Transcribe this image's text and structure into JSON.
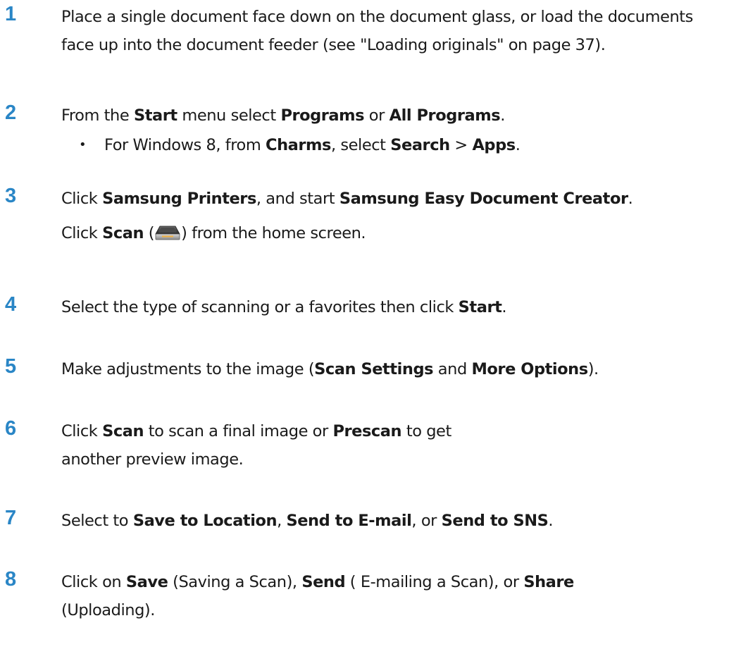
{
  "steps": [
    {
      "number": "1",
      "parts": [
        {
          "t": "Place a single document face down on the document glass, or load the documents face up into the document feeder (see \"Loading originals\" on page 37).",
          "b": false
        }
      ]
    },
    {
      "number": "2",
      "parts": [
        {
          "t": "From the ",
          "b": false
        },
        {
          "t": "Start",
          "b": true
        },
        {
          "t": " menu select ",
          "b": false
        },
        {
          "t": "Programs",
          "b": true
        },
        {
          "t": " or ",
          "b": false
        },
        {
          "t": "All Programs",
          "b": true
        },
        {
          "t": ".",
          "b": false
        }
      ],
      "bullet": [
        {
          "t": "For Windows 8, from ",
          "b": false
        },
        {
          "t": "Charms",
          "b": true
        },
        {
          "t": ", select ",
          "b": false
        },
        {
          "t": "Search",
          "b": true
        },
        {
          "t": " > ",
          "b": false
        },
        {
          "t": "Apps",
          "b": true
        },
        {
          "t": ".",
          "b": false
        }
      ]
    },
    {
      "number": "3",
      "parts": [
        {
          "t": "Click ",
          "b": false
        },
        {
          "t": "Samsung Printers",
          "b": true
        },
        {
          "t": ", and start ",
          "b": false
        },
        {
          "t": "Samsung Easy Document Creator",
          "b": true
        },
        {
          "t": ".",
          "b": false
        }
      ],
      "second_line": {
        "before": [
          {
            "t": "Click ",
            "b": false
          },
          {
            "t": "Scan",
            "b": true
          },
          {
            "t": " (",
            "b": false
          }
        ],
        "icon": "scanner-icon",
        "after": [
          {
            "t": ") from the home screen.",
            "b": false
          }
        ]
      }
    },
    {
      "number": "4",
      "parts": [
        {
          "t": "Select the type of scanning or a favorites then click ",
          "b": false
        },
        {
          "t": "Start",
          "b": true
        },
        {
          "t": ".",
          "b": false
        }
      ]
    },
    {
      "number": "5",
      "parts": [
        {
          "t": "Make adjustments to the image (",
          "b": false
        },
        {
          "t": "Scan Settings",
          "b": true
        },
        {
          "t": " and ",
          "b": false
        },
        {
          "t": "More Options",
          "b": true
        },
        {
          "t": ").",
          "b": false
        }
      ]
    },
    {
      "number": "6",
      "parts": [
        {
          "t": "Click ",
          "b": false
        },
        {
          "t": "Scan",
          "b": true
        },
        {
          "t": " to scan a final image or ",
          "b": false
        },
        {
          "t": "Prescan",
          "b": true
        },
        {
          "t": " to get another preview image.",
          "b": false
        }
      ]
    },
    {
      "number": "7",
      "parts": [
        {
          "t": "Select to ",
          "b": false
        },
        {
          "t": "Save to Location",
          "b": true
        },
        {
          "t": ", ",
          "b": false
        },
        {
          "t": "Send to E-mail",
          "b": true
        },
        {
          "t": ", or ",
          "b": false
        },
        {
          "t": "Send to SNS",
          "b": true
        },
        {
          "t": ".",
          "b": false
        }
      ]
    },
    {
      "number": "8",
      "parts": [
        {
          "t": "Click on ",
          "b": false
        },
        {
          "t": "Save",
          "b": true
        },
        {
          "t": " (Saving a Scan), ",
          "b": false
        },
        {
          "t": "Send",
          "b": true
        },
        {
          "t": " ( E-mailing a Scan), or ",
          "b": false
        },
        {
          "t": "Share",
          "b": true
        },
        {
          "t": " (Uploading).",
          "b": false
        }
      ]
    }
  ],
  "colors": {
    "step_number": "#2a86c6",
    "text": "#1a1a1a"
  }
}
